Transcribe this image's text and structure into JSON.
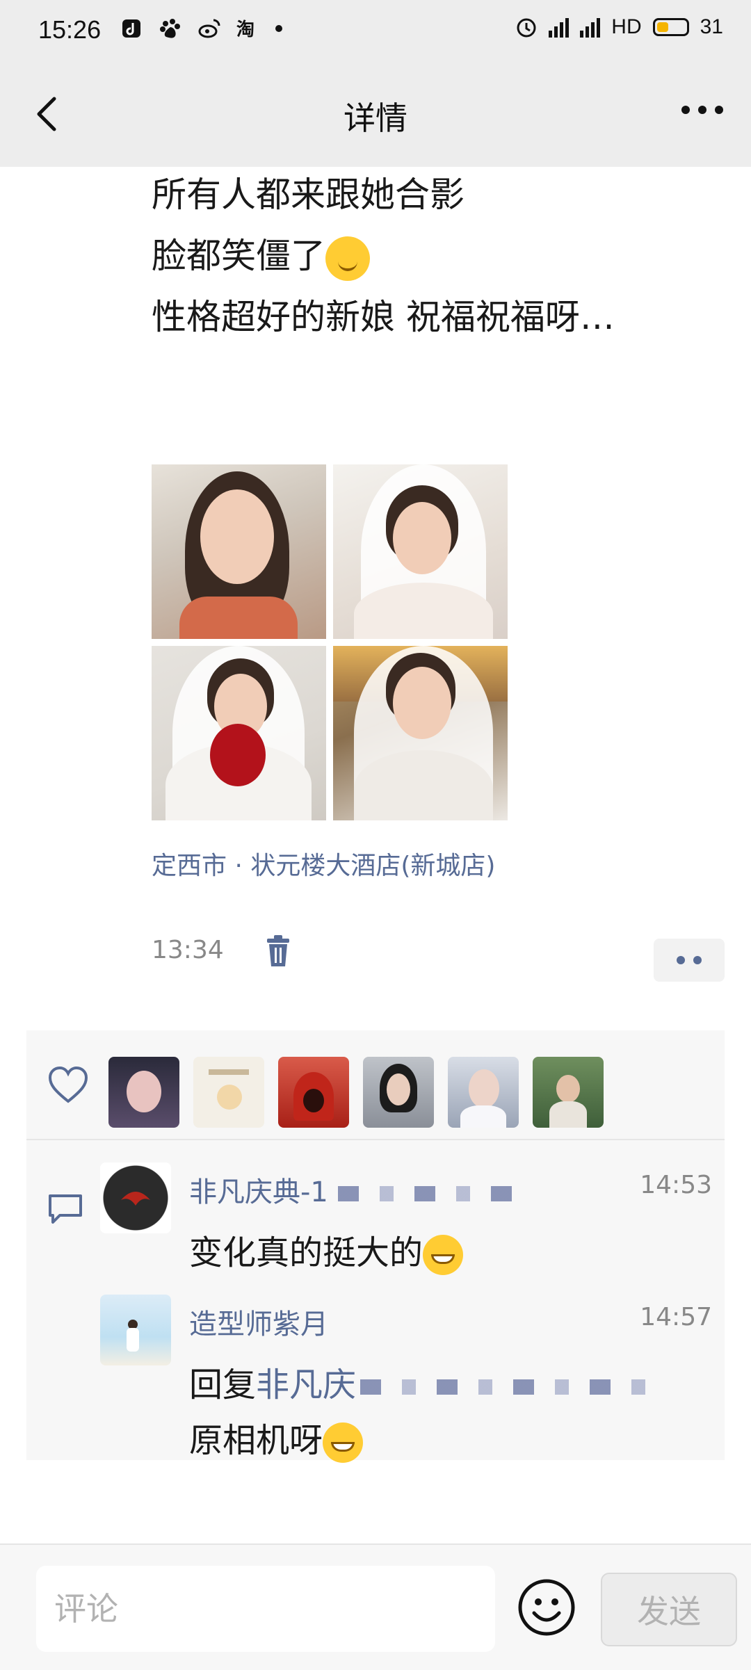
{
  "status_bar": {
    "time": "15:26",
    "app_icons": [
      "tiktok-icon",
      "baidu-icon",
      "weibo-icon",
      "taobao-icon"
    ],
    "network": "4G",
    "hd": "HD",
    "battery": "31"
  },
  "header": {
    "title": "详情"
  },
  "post": {
    "lines": [
      "所有人都来跟她合影",
      "脸都笑僵了",
      "性格超好的新娘   祝福祝福呀…"
    ],
    "location": "定西市 · 状元楼大酒店(新城店)",
    "time": "13:34"
  },
  "comments": [
    {
      "name": "非凡庆典-1",
      "time": "14:53",
      "text": "变化真的挺大的"
    },
    {
      "name": "造型师紫月",
      "time": "14:57",
      "reply_prefix": "回复",
      "reply_to": "非凡庆",
      "text": "原相机呀"
    }
  ],
  "input": {
    "placeholder": "评论",
    "send_label": "发送"
  },
  "colors": {
    "link": "#576b95",
    "nav_bg": "#ededed",
    "panel_bg": "#f7f7f7"
  }
}
